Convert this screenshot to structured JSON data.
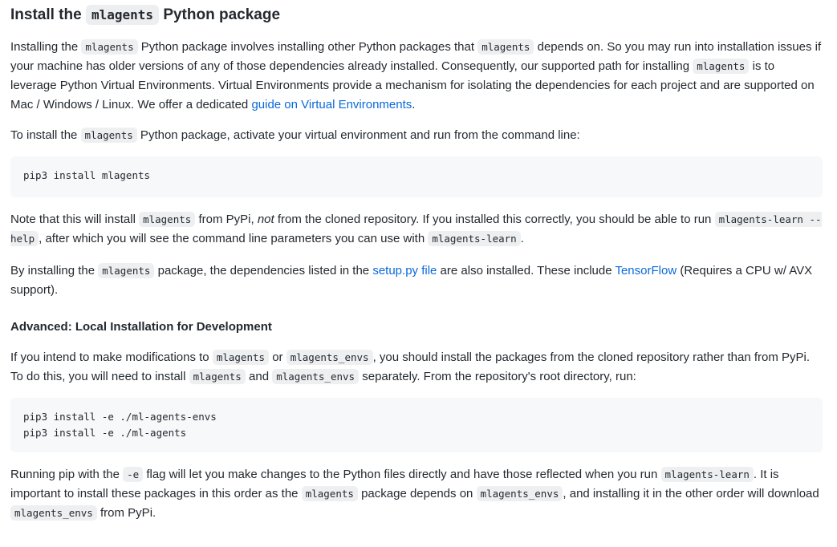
{
  "heading": {
    "prefix": "Install the",
    "code": "mlagents",
    "suffix": "Python package"
  },
  "para1": {
    "t1": "Installing the ",
    "c1": "mlagents",
    "t2": " Python package involves installing other Python packages that ",
    "c2": "mlagents",
    "t3": " depends on. So you may run into installation issues if your machine has older versions of any of those dependencies already installed. Consequently, our supported path for installing ",
    "c3": "mlagents",
    "t4": " is to leverage Python Virtual Environments. Virtual Environments provide a mechanism for isolating the dependencies for each project and are supported on Mac / Windows / Linux. We offer a dedicated ",
    "link": "guide on Virtual Environments",
    "t5": "."
  },
  "para2": {
    "t1": "To install the ",
    "c1": "mlagents",
    "t2": " Python package, activate your virtual environment and run from the command line:"
  },
  "code_block1": {
    "lines": [
      "pip3 install mlagents"
    ]
  },
  "para3": {
    "t1": "Note that this will install ",
    "c1": "mlagents",
    "t2": " from PyPi, ",
    "em": "not",
    "t3": " from the cloned repository. If you installed this correctly, you should be able to run ",
    "c2": "mlagents-learn --help",
    "t4": ", after which you will see the command line parameters you can use with ",
    "c3": "mlagents-learn",
    "t5": "."
  },
  "para4": {
    "t1": "By installing the ",
    "c1": "mlagents",
    "t2": " package, the dependencies listed in the ",
    "link1": "setup.py file",
    "t3": " are also installed. These include ",
    "link2": "TensorFlow",
    "t4": " (Requires a CPU w/ AVX support)."
  },
  "subheading": "Advanced: Local Installation for Development",
  "para5": {
    "t1": "If you intend to make modifications to ",
    "c1": "mlagents",
    "t2": " or ",
    "c2": "mlagents_envs",
    "t3": ", you should install the packages from the cloned repository rather than from PyPi. To do this, you will need to install ",
    "c3": "mlagents",
    "t4": " and ",
    "c4": "mlagents_envs",
    "t5": " separately. From the repository's root directory, run:"
  },
  "code_block2": {
    "line1": "pip3 install -e ./ml-agents-envs",
    "line2": "pip3 install -e ./ml-agents"
  },
  "para6": {
    "t1": "Running pip with the ",
    "c1": "-e",
    "t2": " flag will let you make changes to the Python files directly and have those reflected when you run ",
    "c2": "mlagents-learn",
    "t3": ". It is important to install these packages in this order as the ",
    "c3": "mlagents",
    "t4": " package depends on ",
    "c4": "mlagents_envs",
    "t5": ", and installing it in the other order will download ",
    "c5": "mlagents_envs",
    "t6": " from PyPi."
  },
  "colors": {
    "link": "#0969da",
    "text": "#24292f",
    "code_bg": "#f6f8fa"
  }
}
